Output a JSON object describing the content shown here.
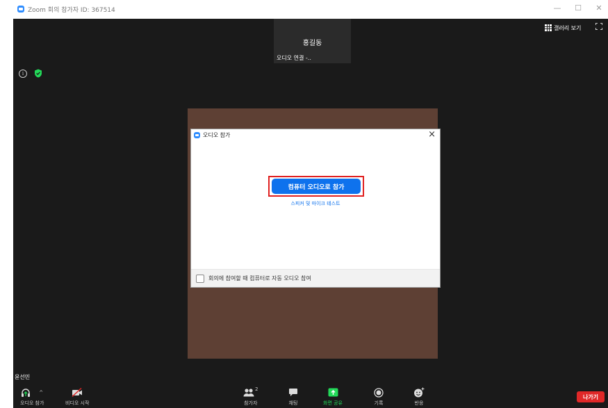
{
  "window": {
    "title": "Zoom 회의 참가자 ID: 367514",
    "minimize": "—",
    "maximize": "☐",
    "close": "✕"
  },
  "meeting": {
    "speaker_name": "홍길동",
    "speaker_status": "오디오 연결 -..",
    "gallery_view_label": "갤러리 보기",
    "self_name": "윤선민"
  },
  "dialog": {
    "title": "오디오 참가",
    "close": "×",
    "join_button_label": "컴퓨터 오디오로 참가",
    "test_link_label": "스피커 및 마이크 테스트",
    "auto_join_checkbox_label": "회의에 참여할 때 컴퓨터로 자동 오디오 참여",
    "auto_join_checked": false
  },
  "toolbar": {
    "audio_label": "오디오 참가",
    "audio_caret": "^",
    "video_label": "비디오 시작",
    "participants_label": "참가자",
    "participants_count": "2",
    "chat_label": "채팅",
    "share_label": "화면 공유",
    "record_label": "기록",
    "reactions_label": "반응",
    "leave_label": "나가기"
  },
  "colors": {
    "accent_blue": "#0e72ed",
    "share_green": "#23d959",
    "leave_red": "#e02828",
    "highlight_red": "#e02020",
    "video_bg": "#5e4034"
  },
  "icons": {
    "app": "zoom-logo-icon",
    "info": "info-icon",
    "security": "shield-icon",
    "gallery": "grid-icon",
    "fullscreen": "fullscreen-icon",
    "audio": "headphone-icon",
    "video": "video-off-icon",
    "participants": "participants-icon",
    "chat": "chat-icon",
    "share": "share-screen-icon",
    "record": "record-icon",
    "reactions": "smiley-icon"
  }
}
